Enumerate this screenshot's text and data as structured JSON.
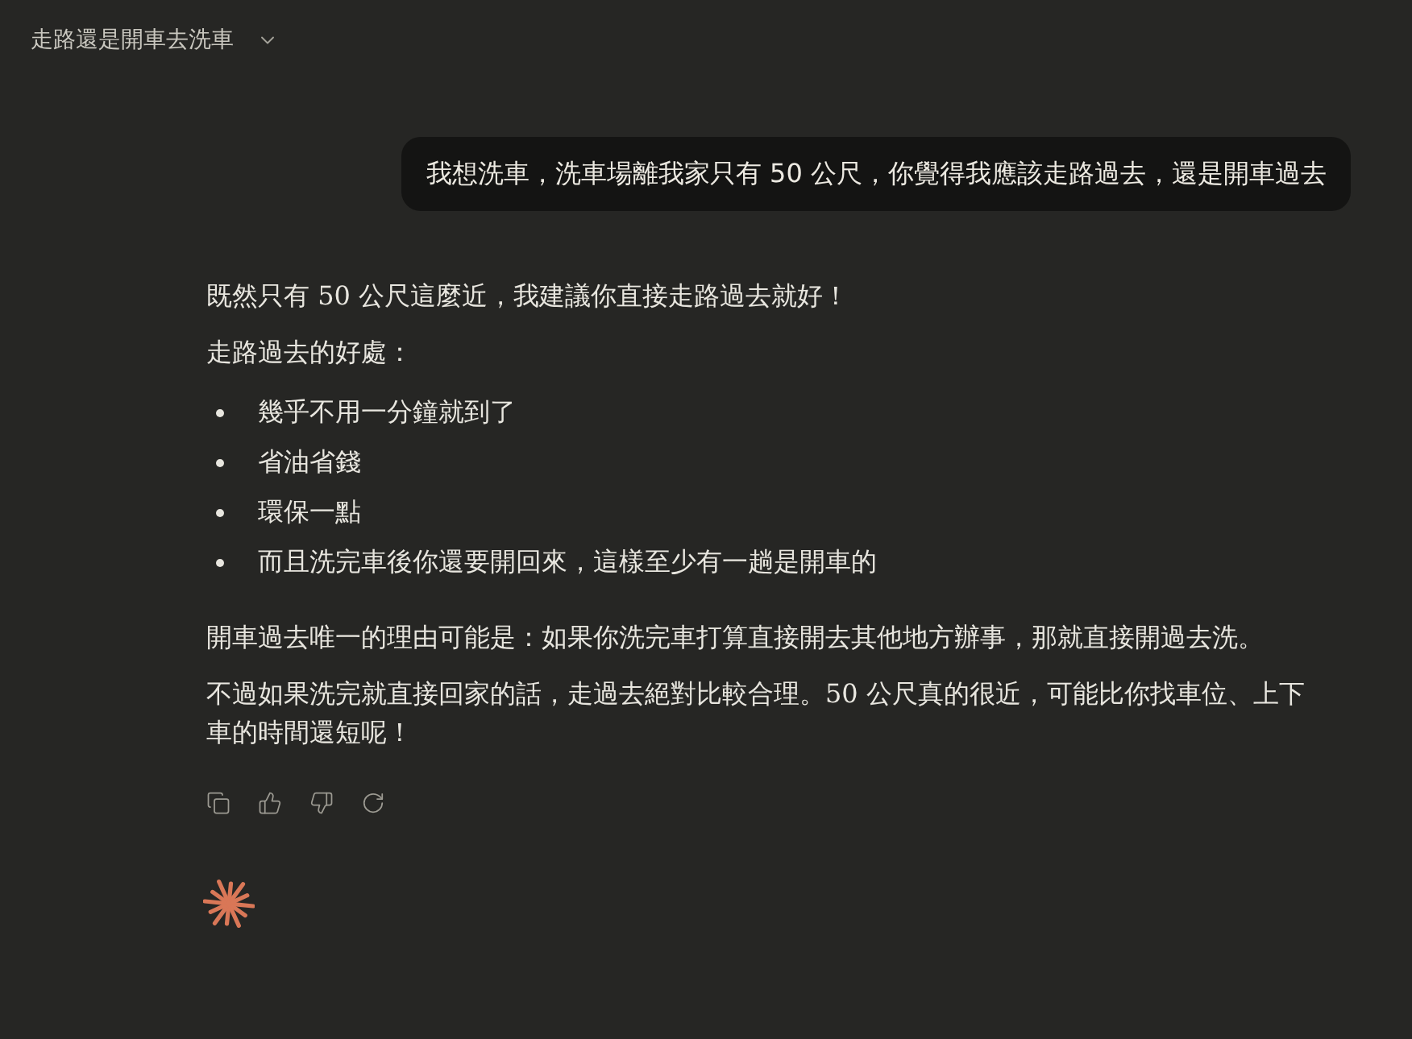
{
  "conversation": {
    "title": "走路還是開車去洗車"
  },
  "user_message": {
    "text": "我想洗車，洗車場離我家只有 50 公尺，你覺得我應該走路過去，還是開車過去"
  },
  "response": {
    "blocks": [
      {
        "kind": "paragraph",
        "text": "既然只有 50 公尺這麼近，我建議你直接走路過去就好！"
      },
      {
        "kind": "paragraph",
        "text": "走路過去的好處："
      },
      {
        "kind": "list",
        "items": [
          "幾乎不用一分鐘就到了",
          "省油省錢",
          "環保一點",
          "而且洗完車後你還要開回來，這樣至少有一趟是開車的"
        ]
      },
      {
        "kind": "paragraph",
        "text": "開車過去唯一的理由可能是：如果你洗完車打算直接開去其他地方辦事，那就直接開過去洗。"
      },
      {
        "kind": "paragraph",
        "text": "不過如果洗完就直接回家的話，走過去絕對比較合理。50 公尺真的很近，可能比你找車位、上下車的時間還短呢！"
      }
    ]
  }
}
